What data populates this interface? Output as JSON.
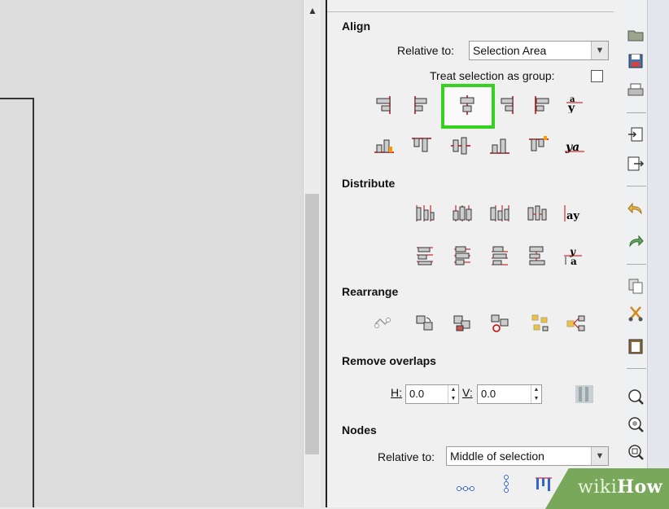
{
  "align": {
    "title": "Align",
    "relative_label": "Relative to:",
    "relative_value": "Selection Area",
    "treat_group_label": "Treat selection as group:"
  },
  "distribute": {
    "title": "Distribute"
  },
  "rearrange": {
    "title": "Rearrange"
  },
  "remove_overlaps": {
    "title": "Remove overlaps",
    "h_label": "H:",
    "h_value": "0.0",
    "v_label": "V:",
    "v_value": "0.0"
  },
  "nodes": {
    "title": "Nodes",
    "relative_label": "Relative to:",
    "relative_value": "Middle of selection"
  },
  "watermark": {
    "wiki": "wiki",
    "how": "How"
  },
  "colors": {
    "highlight": "#34d21f",
    "accent_red": "#cc0000"
  }
}
